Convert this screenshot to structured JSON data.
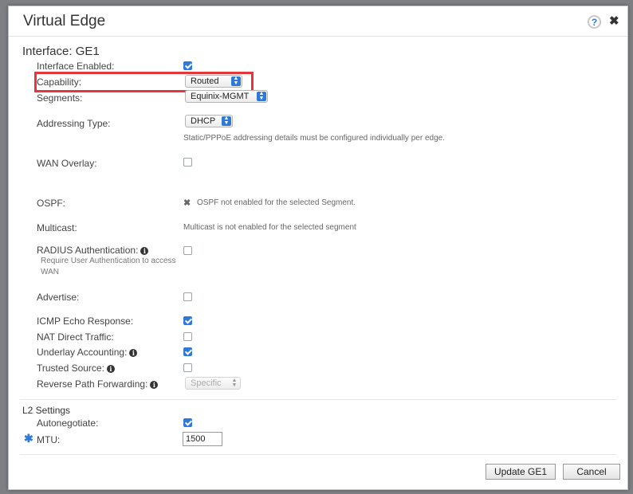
{
  "dialog": {
    "title": "Virtual Edge",
    "help_label": "?",
    "close_label": "✖"
  },
  "interface": {
    "section_title": "Interface: GE1",
    "interface_enabled": {
      "label": "Interface Enabled:",
      "checked": true
    },
    "capability": {
      "label": "Capability:",
      "value": "Routed"
    },
    "segments": {
      "label": "Segments:",
      "value": "Equinix-MGMT"
    },
    "addressing_type": {
      "label": "Addressing Type:",
      "value": "DHCP",
      "hint": "Static/PPPoE addressing details must be configured individually per edge."
    },
    "wan_overlay": {
      "label": "WAN Overlay:",
      "checked": false
    },
    "ospf": {
      "label": "OSPF:",
      "status": "OSPF not enabled for the selected Segment.",
      "icon": "x-icon"
    },
    "multicast": {
      "label": "Multicast:",
      "status": "Multicast is not enabled for the selected segment"
    },
    "radius_authentication": {
      "label": "RADIUS Authentication:",
      "sublabel": "Require User Authentication to access WAN",
      "checked": false
    },
    "advertise": {
      "label": "Advertise:",
      "checked": false
    },
    "icmp_echo_response": {
      "label": "ICMP Echo Response:",
      "checked": true
    },
    "nat_direct_traffic": {
      "label": "NAT Direct Traffic:",
      "checked": false
    },
    "underlay_accounting": {
      "label": "Underlay Accounting:",
      "checked": true
    },
    "trusted_source": {
      "label": "Trusted Source:",
      "checked": false
    },
    "reverse_path_forwarding": {
      "label": "Reverse Path Forwarding:",
      "value": "Specific"
    }
  },
  "l2_settings": {
    "section_title": "L2 Settings",
    "autonegotiate": {
      "label": "Autonegotiate:",
      "checked": true
    },
    "mtu": {
      "label": "MTU:",
      "value": "1500",
      "required_marker": "✱"
    }
  },
  "footer": {
    "update_label": "Update GE1",
    "cancel_label": "Cancel"
  },
  "colors": {
    "accent": "#2f7ad8",
    "highlight": "#e3373c"
  }
}
